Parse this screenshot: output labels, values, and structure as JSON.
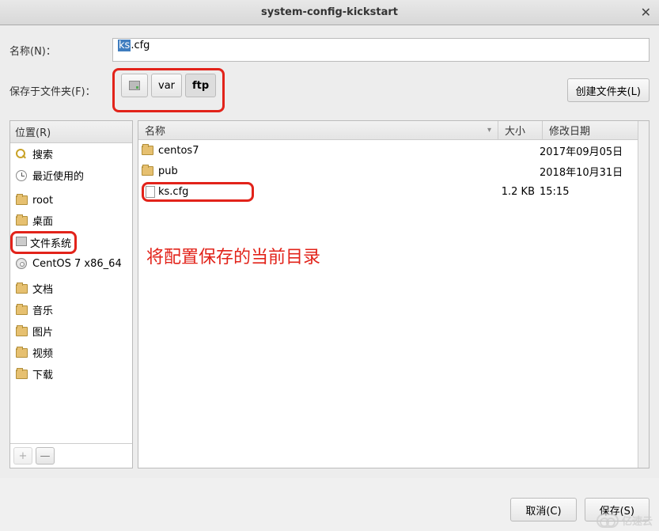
{
  "title": "system-config-kickstart",
  "labels": {
    "name": "名称(N)：",
    "save_in": "保存于文件夹(F)：",
    "create_folder": "创建文件夹(L)",
    "places": "位置(R)",
    "col_name": "名称",
    "col_size": "大小",
    "col_date": "修改日期",
    "cancel": "取消(C)",
    "save": "保存(S)",
    "add": "+",
    "remove": "—"
  },
  "filename": {
    "selected": "ks",
    "rest": ".cfg"
  },
  "path": [
    {
      "label": "",
      "icon": "drive",
      "active": false
    },
    {
      "label": "var",
      "active": false
    },
    {
      "label": "ftp",
      "active": true
    }
  ],
  "places_list": [
    {
      "icon": "search",
      "label": "搜索"
    },
    {
      "icon": "clock",
      "label": "最近使用的"
    },
    {
      "icon": "folder",
      "label": "root"
    },
    {
      "icon": "folder",
      "label": "桌面"
    },
    {
      "icon": "drive",
      "label": "文件系统",
      "highlight": true
    },
    {
      "icon": "disc",
      "label": "CentOS 7 x86_64"
    },
    {
      "icon": "folder",
      "label": "文档"
    },
    {
      "icon": "folder",
      "label": "音乐"
    },
    {
      "icon": "folder",
      "label": "图片"
    },
    {
      "icon": "folder",
      "label": "视频"
    },
    {
      "icon": "folder",
      "label": "下载"
    }
  ],
  "files": [
    {
      "type": "folder",
      "name": "centos7",
      "size": "",
      "date": "2017年09月05日"
    },
    {
      "type": "folder",
      "name": "pub",
      "size": "",
      "date": "2018年10月31日"
    },
    {
      "type": "file",
      "name": "ks.cfg",
      "size": "1.2 KB",
      "date": "15:15",
      "highlight": true
    }
  ],
  "annotation": "将配置保存的当前目录",
  "watermark": "亿速云"
}
